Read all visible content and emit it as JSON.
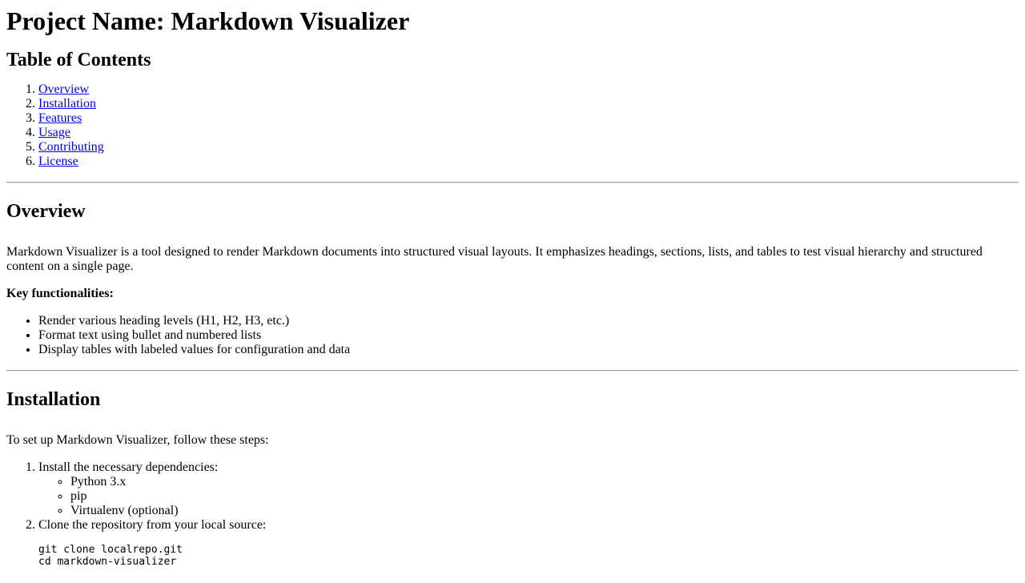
{
  "title": "Project Name: Markdown Visualizer",
  "toc": {
    "heading": "Table of Contents",
    "items": [
      "Overview",
      "Installation",
      "Features",
      "Usage",
      "Contributing",
      "License"
    ]
  },
  "overview": {
    "heading": "Overview",
    "paragraph": "Markdown Visualizer is a tool designed to render Markdown documents into structured visual layouts. It emphasizes headings, sections, lists, and tables to test visual hierarchy and structured content on a single page.",
    "key_label": "Key functionalities:",
    "bullets": [
      "Render various heading levels (H1, H2, H3, etc.)",
      "Format text using bullet and numbered lists",
      "Display tables with labeled values for configuration and data"
    ]
  },
  "installation": {
    "heading": "Installation",
    "intro": "To set up Markdown Visualizer, follow these steps:",
    "step1": "Install the necessary dependencies:",
    "deps": [
      "Python 3.x",
      "pip",
      "Virtualenv (optional)"
    ],
    "step2": "Clone the repository from your local source:",
    "code": [
      "git clone localrepo.git",
      "cd markdown-visualizer"
    ]
  }
}
